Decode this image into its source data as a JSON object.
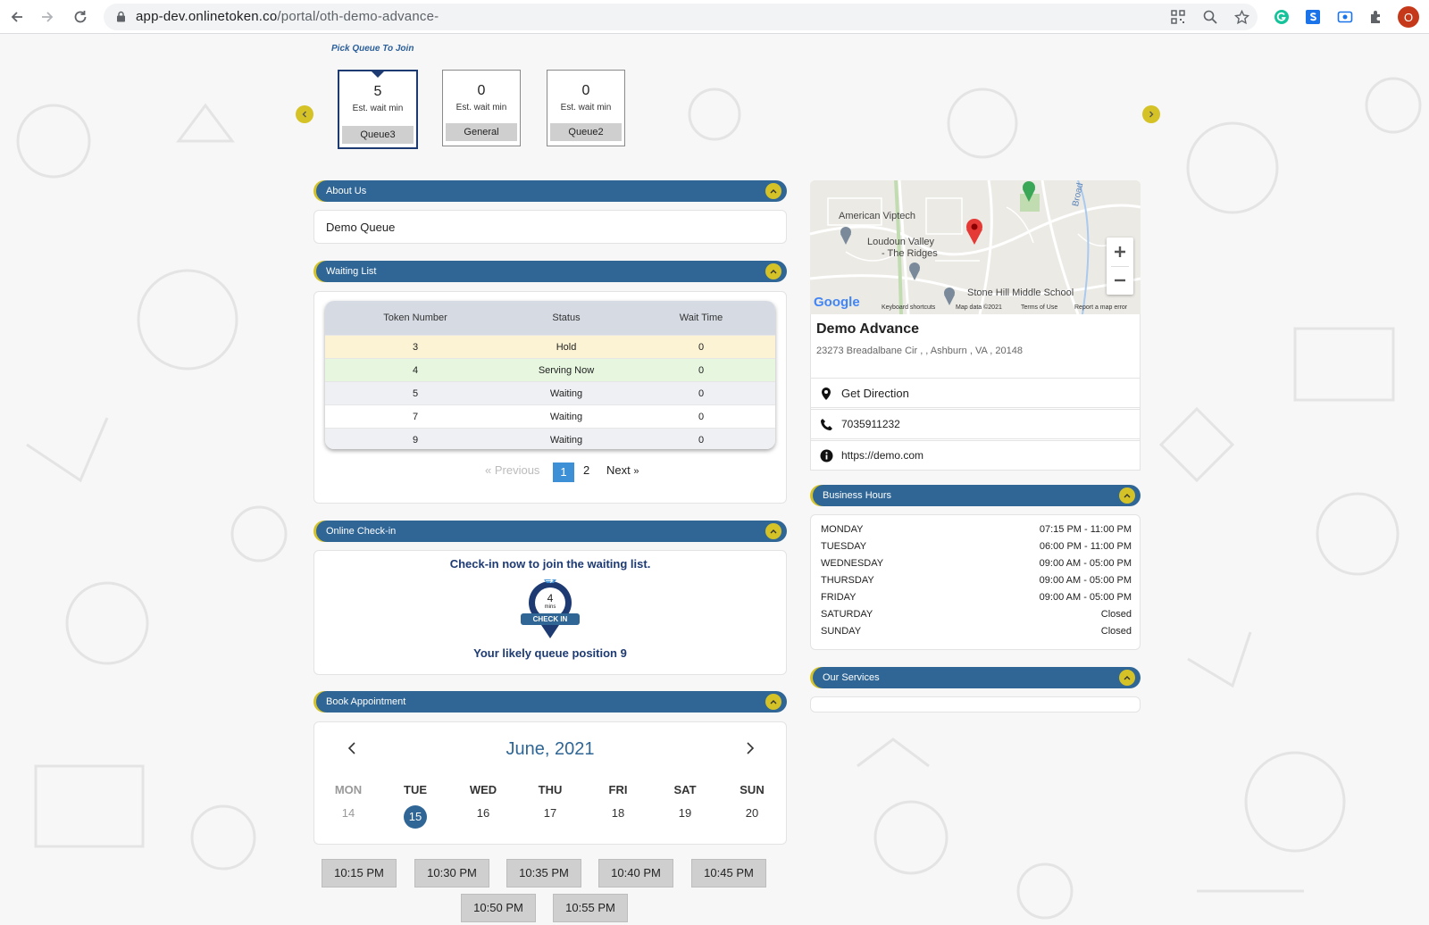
{
  "browser": {
    "url_host": "app-dev.onlinetoken.co",
    "url_path": "/portal/oth-demo-advance-",
    "profile_initial": "O"
  },
  "queue_picker": {
    "title": "Pick Queue To Join",
    "queues": [
      {
        "count": "5",
        "label": "Est. wait min",
        "name": "Queue3",
        "selected": true
      },
      {
        "count": "0",
        "label": "Est. wait min",
        "name": "General",
        "selected": false
      },
      {
        "count": "0",
        "label": "Est. wait min",
        "name": "Queue2",
        "selected": false
      }
    ]
  },
  "about": {
    "title": "About Us",
    "text": "Demo Queue"
  },
  "waiting_list": {
    "title": "Waiting List",
    "columns": [
      "Token Number",
      "Status",
      "Wait Time"
    ],
    "rows": [
      {
        "token": "3",
        "status": "Hold",
        "wait": "0"
      },
      {
        "token": "4",
        "status": "Serving Now",
        "wait": "0"
      },
      {
        "token": "5",
        "status": "Waiting",
        "wait": "0"
      },
      {
        "token": "7",
        "status": "Waiting",
        "wait": "0"
      },
      {
        "token": "9",
        "status": "Waiting",
        "wait": "0"
      }
    ],
    "pagination": {
      "prev": "Previous",
      "pages": [
        "1",
        "2"
      ],
      "current": "1",
      "next": "Next"
    }
  },
  "online_checkin": {
    "title": "Online Check-in",
    "heading": "Check-in now to join the waiting list.",
    "badge_number": "4",
    "badge_unit": "mins",
    "badge_label": "CHECK IN",
    "position_text": "Your likely queue position 9"
  },
  "appointment": {
    "title": "Book Appointment",
    "month": "June, 2021",
    "days": [
      {
        "dow": "MON",
        "date": "14",
        "muted": true
      },
      {
        "dow": "TUE",
        "date": "15",
        "selected": true
      },
      {
        "dow": "WED",
        "date": "16"
      },
      {
        "dow": "THU",
        "date": "17"
      },
      {
        "dow": "FRI",
        "date": "18"
      },
      {
        "dow": "SAT",
        "date": "19"
      },
      {
        "dow": "SUN",
        "date": "20"
      }
    ],
    "slots": [
      "10:15 PM",
      "10:30 PM",
      "10:35 PM",
      "10:40 PM",
      "10:45 PM",
      "10:50 PM",
      "10:55 PM"
    ]
  },
  "map": {
    "labels": {
      "place1": "American Viptech",
      "place2": "Loudoun Valley",
      "place3": "- The Ridges",
      "school": "Stone Hill Middle School",
      "road": "Broad Run",
      "logo": "Google",
      "keyboard": "Keyboard shortcuts",
      "mapdata": "Map data ©2021",
      "terms": "Terms of Use",
      "report": "Report a map error"
    }
  },
  "business": {
    "name": "Demo Advance",
    "address": "23273 Breadalbane Cir , , Ashburn , VA , 20148",
    "direction_label": "Get Direction",
    "phone": "7035911232",
    "website": "https://demo.com"
  },
  "business_hours": {
    "title": "Business Hours",
    "rows": [
      {
        "day": "MONDAY",
        "hours": "07:15 PM - 11:00 PM"
      },
      {
        "day": "TUESDAY",
        "hours": "06:00 PM - 11:00 PM"
      },
      {
        "day": "WEDNESDAY",
        "hours": "09:00 AM - 05:00 PM"
      },
      {
        "day": "THURSDAY",
        "hours": "09:00 AM - 05:00 PM"
      },
      {
        "day": "FRIDAY",
        "hours": "09:00 AM - 05:00 PM"
      },
      {
        "day": "SATURDAY",
        "hours": "Closed"
      },
      {
        "day": "SUNDAY",
        "hours": "Closed"
      }
    ]
  },
  "services": {
    "title": "Our Services"
  },
  "colors": {
    "primary": "#2f6696",
    "accent": "#d4c226",
    "navy": "#1d3a72",
    "hold_row": "#fbf3d3",
    "serving_row": "#e6f6df"
  }
}
